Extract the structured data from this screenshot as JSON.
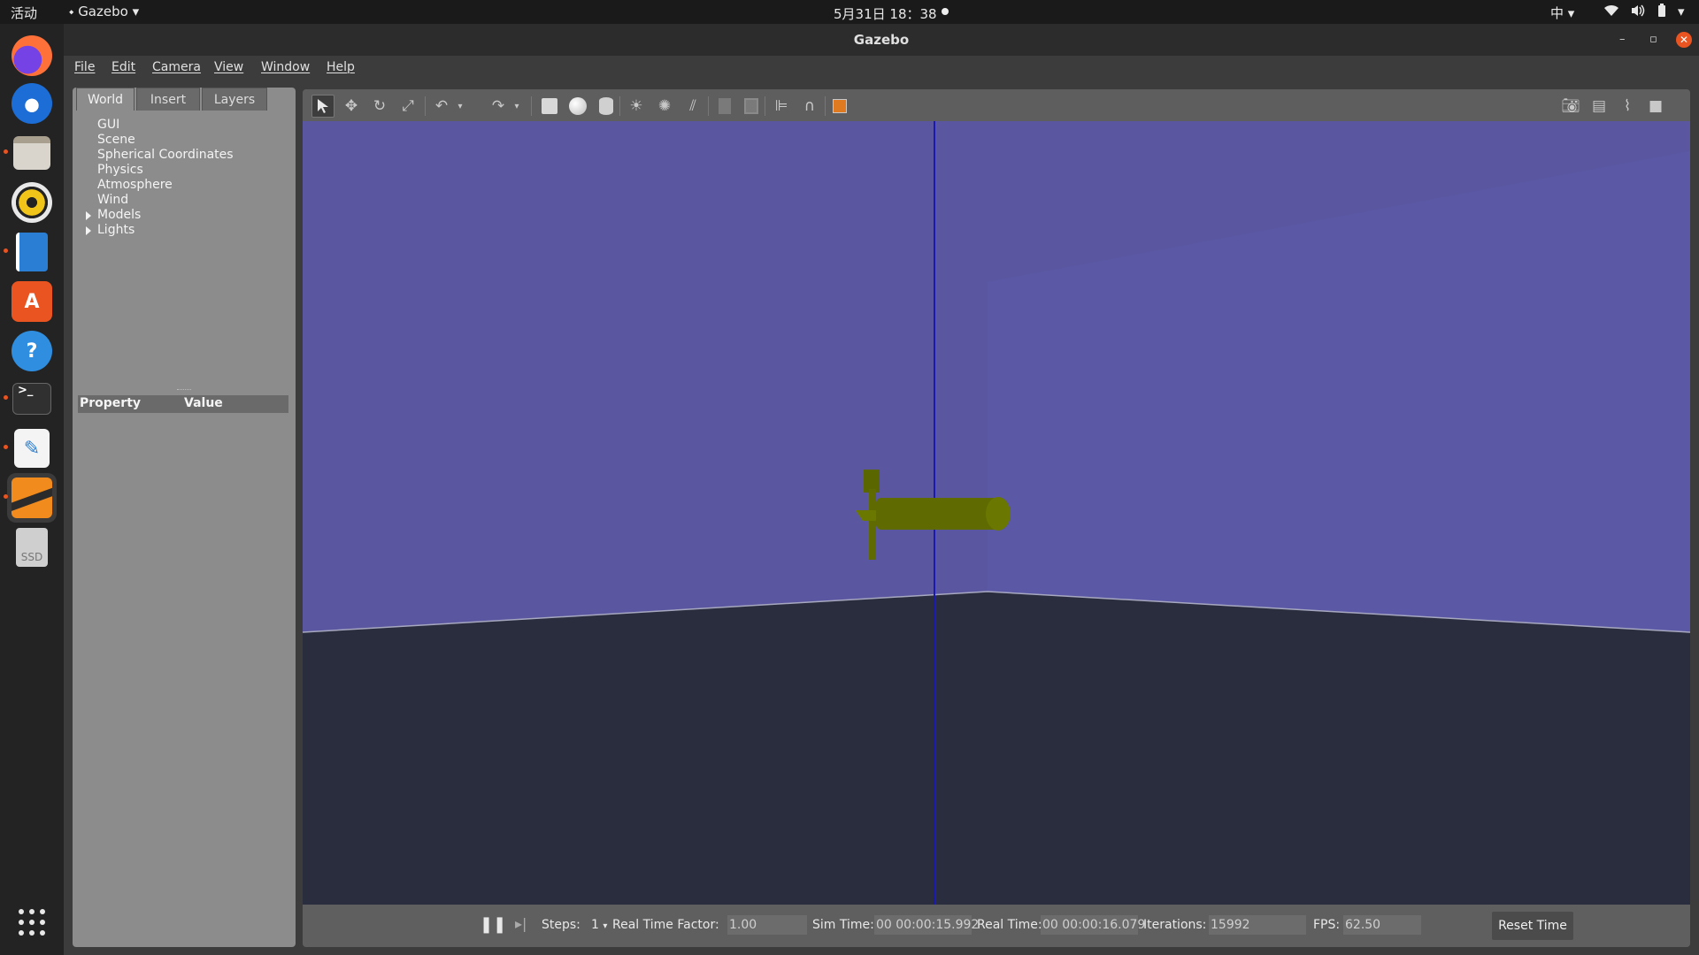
{
  "topbar": {
    "activities": "活动",
    "app_name": "Gazebo",
    "clock": "5月31日  18：38",
    "ime": "中"
  },
  "window": {
    "title": "Gazebo"
  },
  "menu": [
    "File",
    "Edit",
    "Camera",
    "View",
    "Window",
    "Help"
  ],
  "left_panel": {
    "tabs": [
      "World",
      "Insert",
      "Layers"
    ],
    "active_tab": "World",
    "tree": [
      {
        "label": "GUI",
        "expandable": false
      },
      {
        "label": "Scene",
        "expandable": false
      },
      {
        "label": "Spherical Coordinates",
        "expandable": false
      },
      {
        "label": "Physics",
        "expandable": false
      },
      {
        "label": "Atmosphere",
        "expandable": false
      },
      {
        "label": "Wind",
        "expandable": false
      },
      {
        "label": "Models",
        "expandable": true
      },
      {
        "label": "Lights",
        "expandable": true
      }
    ],
    "property_header": {
      "property": "Property",
      "value": "Value"
    }
  },
  "dock": {
    "items": [
      "firefox-icon",
      "thunderbird-icon",
      "files-icon",
      "rhythmbox-icon",
      "writer-icon",
      "software-center-icon",
      "help-icon",
      "terminal-icon",
      "text-editor-icon",
      "gazebo-icon",
      "ssd-drive-icon",
      "show-apps-icon"
    ],
    "ssd_label": "SSD"
  },
  "bottom_bar": {
    "steps_label": "Steps:",
    "steps_value": "1",
    "rtf_label": "Real Time Factor:",
    "rtf_value": "1.00",
    "sim_time_label": "Sim Time:",
    "sim_time_value": "00 00:00:15.992",
    "real_time_label": "Real Time:",
    "real_time_value": "00 00:00:16.079",
    "iterations_label": "Iterations:",
    "iterations_value": "15992",
    "fps_label": "FPS:",
    "fps_value": "62.50",
    "reset_label": "Reset Time"
  },
  "colors": {
    "sky": "#5a57a0",
    "ground": "#2a2d3e",
    "model": "#5f6b00",
    "axis": "#1a1ab0",
    "accent": "#e95420"
  }
}
